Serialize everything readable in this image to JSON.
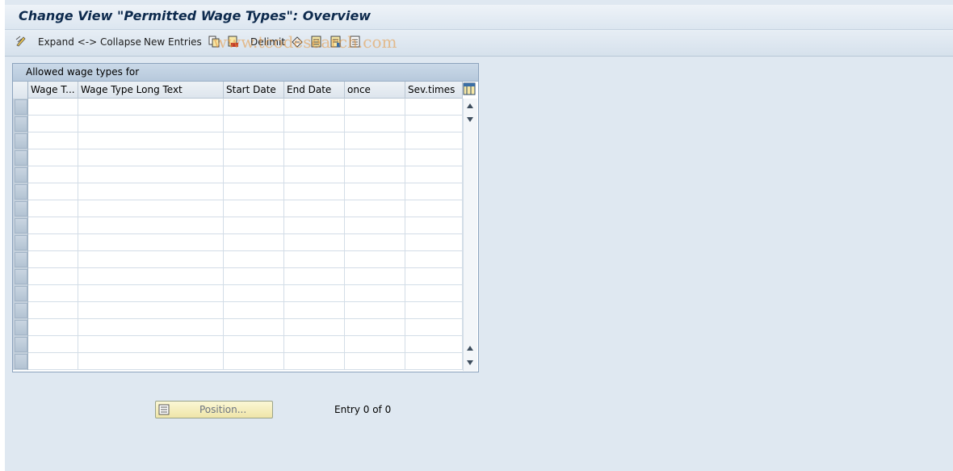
{
  "title": "Change View \"Permitted Wage Types\": Overview",
  "toolbar": {
    "expand_collapse": "Expand <-> Collapse",
    "new_entries": "New Entries",
    "delimit": "Delimit",
    "watermark": "www.tcodesearch.com"
  },
  "table": {
    "title": "Allowed wage types for",
    "columns": [
      "Wage T...",
      "Wage Type Long Text",
      "Start Date",
      "End Date",
      "once",
      "Sev.times"
    ],
    "rows": []
  },
  "footer": {
    "position_label": "Position...",
    "entry_text": "Entry 0 of 0"
  }
}
